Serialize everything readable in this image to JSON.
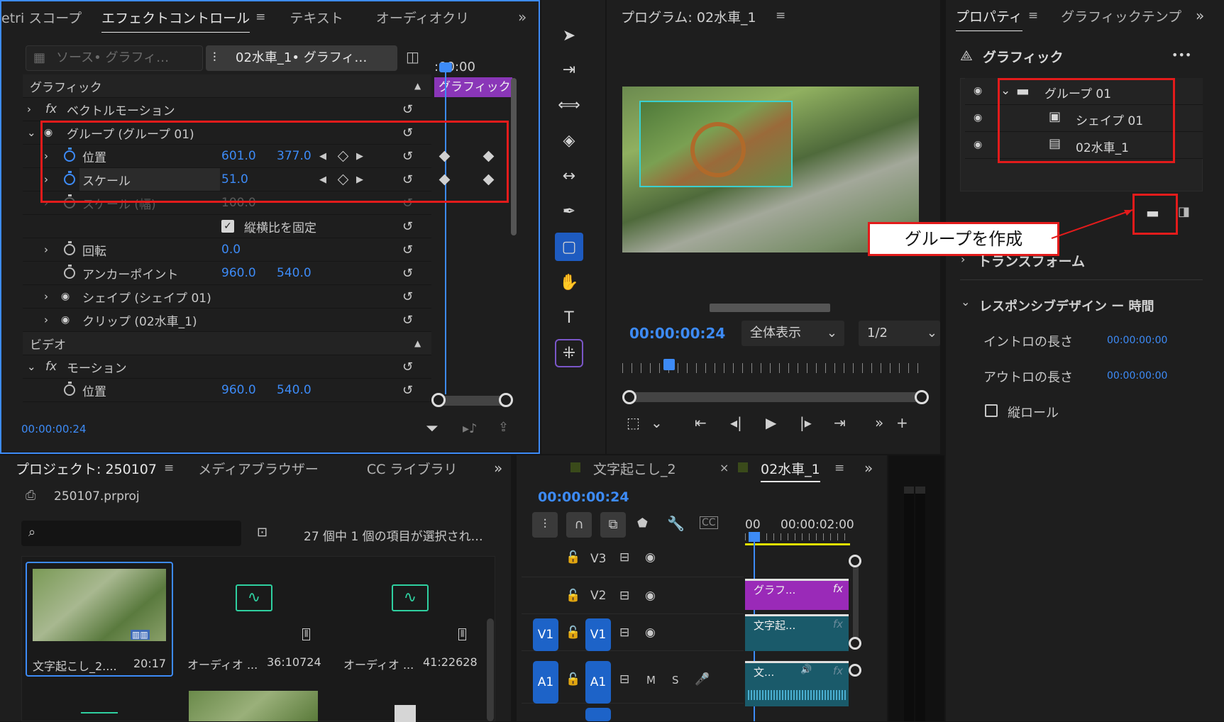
{
  "effect_panel": {
    "tabs": [
      "etri スコープ",
      "エフェクトコントロール",
      "テキスト",
      "オーディオクリ"
    ],
    "source_tab": "ソース• グラフィ…",
    "clip_tab": "02水車_1• グラフィ…",
    "ruler_time": ":00:00",
    "clip_bar_label": "グラフィック",
    "section_graphic": "グラフィック",
    "vector_motion": "ベクトルモーション",
    "group": "グループ (グループ 01)",
    "position_label": "位置",
    "position_x": "601.0",
    "position_y": "377.0",
    "scale_label": "スケール",
    "scale_value": "51.0",
    "scale_width_label": "スケール (幅)",
    "scale_width_value": "100.0",
    "uniform_scale": "縦横比を固定",
    "rotation_label": "回転",
    "rotation_value": "0.0",
    "anchor_label": "アンカーポイント",
    "anchor_x": "960.0",
    "anchor_y": "540.0",
    "shape_item": "シェイプ (シェイプ 01)",
    "clip_item": "クリップ (02水車_1)",
    "section_video": "ビデオ",
    "motion": "モーション",
    "motion_position_label": "位置",
    "motion_x": "960.0",
    "motion_y": "540.0",
    "timecode": "00:00:00:24"
  },
  "program_monitor": {
    "title": "プログラム: 02水車_1",
    "timecode": "00:00:00:24",
    "zoom": "全体表示",
    "resolution": "1/2"
  },
  "properties_panel": {
    "tabs": [
      "プロパティ",
      "グラフィックテンプ"
    ],
    "section": "グラフィック",
    "more": "•••",
    "layers": [
      {
        "name": "グループ 01",
        "type": "group"
      },
      {
        "name": "シェイプ 01",
        "type": "shape"
      },
      {
        "name": "02水車_1",
        "type": "clip"
      }
    ],
    "transform": "トランスフォーム",
    "responsive": "レスポンシブデザイン ー 時間",
    "intro_label": "イントロの長さ",
    "intro_value": "00:00:00:00",
    "outro_label": "アウトロの長さ",
    "outro_value": "00:00:00:00",
    "roll": "縦ロール"
  },
  "callout": {
    "text": "グループを作成"
  },
  "project_panel": {
    "tabs": [
      "プロジェクト: 250107",
      "メディアブラウザー",
      "CC ライブラリ"
    ],
    "file": "250107.prproj",
    "search_placeholder": "",
    "status": "27 個中 1 個の項目が選択され…",
    "items": [
      {
        "name": "文字起こし_2....",
        "duration": "20:17"
      },
      {
        "name": "オーディオ ...",
        "duration": "36:10724"
      },
      {
        "name": "オーディオ ...",
        "duration": "41:22628"
      }
    ]
  },
  "timeline": {
    "tabs": [
      "文字起こし_2",
      "02水車_1"
    ],
    "close": "×",
    "timecode": "00:00:00:24",
    "ruler_start": "00",
    "ruler_time": "00:00:02:00",
    "tracks": [
      {
        "name": "V3",
        "src": "",
        "label": ""
      },
      {
        "name": "V2",
        "src": "",
        "label": "グラフ..."
      },
      {
        "name": "V1",
        "src": "V1",
        "label": "文字起..."
      },
      {
        "name": "A1",
        "src": "A1",
        "label": "文..."
      }
    ],
    "m": "M",
    "s": "S",
    "fx": "fx"
  }
}
